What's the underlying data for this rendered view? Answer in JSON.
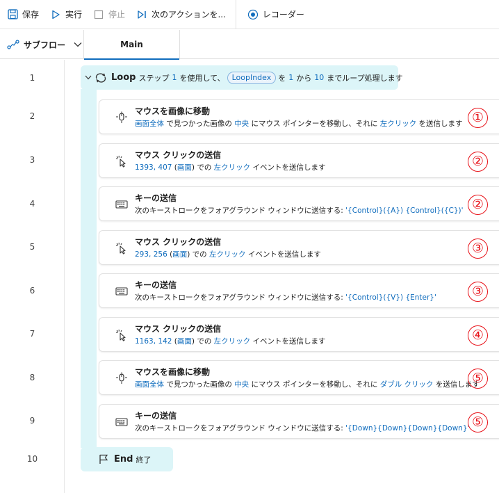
{
  "toolbar": {
    "save": "保存",
    "run": "実行",
    "stop": "停止",
    "next_action": "次のアクションを...",
    "recorder": "レコーダー"
  },
  "tabs": {
    "subflow": "サブフロー",
    "main": "Main"
  },
  "line_numbers": [
    "1",
    "2",
    "3",
    "4",
    "5",
    "6",
    "7",
    "8",
    "9",
    "10"
  ],
  "loop": {
    "keyword": "Loop",
    "t1": "ステップ",
    "step": "1",
    "t2": "を使用して、",
    "var": "LoopIndex",
    "t3": "を",
    "from": "1",
    "t4": "から",
    "to": "10",
    "t5": "までループ処理します"
  },
  "end": {
    "keyword": "End",
    "label": "終了"
  },
  "actions": [
    {
      "title": "マウスを画像に移動",
      "icon": "mouse-image-icon",
      "badge": "①",
      "desc": [
        {
          "t": "画面全体",
          "v": true
        },
        {
          "t": " で見つかった画像の "
        },
        {
          "t": "中央",
          "v": true
        },
        {
          "t": " にマウス ポインターを移動し、それに "
        },
        {
          "t": "左クリック",
          "v": true
        },
        {
          "t": " を送信します"
        }
      ]
    },
    {
      "title": "マウス クリックの送信",
      "icon": "mouse-click-icon",
      "badge": "②",
      "desc": [
        {
          "t": "1393, 407",
          "v": true
        },
        {
          "t": " ("
        },
        {
          "t": "画面",
          "v": true
        },
        {
          "t": ") での "
        },
        {
          "t": "左クリック",
          "v": true
        },
        {
          "t": " イベントを送信します"
        }
      ]
    },
    {
      "title": "キーの送信",
      "icon": "keyboard-icon",
      "badge": "②",
      "desc": [
        {
          "t": "次のキーストロークをフォアグラウンド ウィンドウに送信する: "
        },
        {
          "t": "'{Control}({A}) {Control}({C})'",
          "v": true
        }
      ]
    },
    {
      "title": "マウス クリックの送信",
      "icon": "mouse-click-icon",
      "badge": "③",
      "desc": [
        {
          "t": "293, 256",
          "v": true
        },
        {
          "t": " ("
        },
        {
          "t": "画面",
          "v": true
        },
        {
          "t": ") での "
        },
        {
          "t": "左クリック",
          "v": true
        },
        {
          "t": " イベントを送信します"
        }
      ]
    },
    {
      "title": "キーの送信",
      "icon": "keyboard-icon",
      "badge": "③",
      "desc": [
        {
          "t": "次のキーストロークをフォアグラウンド ウィンドウに送信する: "
        },
        {
          "t": "'{Control}({V}) {Enter}'",
          "v": true
        }
      ]
    },
    {
      "title": "マウス クリックの送信",
      "icon": "mouse-click-icon",
      "badge": "④",
      "desc": [
        {
          "t": "1163, 142",
          "v": true
        },
        {
          "t": " ("
        },
        {
          "t": "画面",
          "v": true
        },
        {
          "t": ") での "
        },
        {
          "t": "左クリック",
          "v": true
        },
        {
          "t": " イベントを送信します"
        }
      ]
    },
    {
      "title": "マウスを画像に移動",
      "icon": "mouse-image-icon",
      "badge": "⑤",
      "desc": [
        {
          "t": "画面全体",
          "v": true
        },
        {
          "t": " で見つかった画像の "
        },
        {
          "t": "中央",
          "v": true
        },
        {
          "t": " にマウス ポインターを移動し、それに "
        },
        {
          "t": "ダブル クリック",
          "v": true
        },
        {
          "t": " を送信します"
        }
      ]
    },
    {
      "title": "キーの送信",
      "icon": "keyboard-icon",
      "badge": "⑤",
      "desc": [
        {
          "t": "次のキーストロークをフォアグラウンド ウィンドウに送信する: "
        },
        {
          "t": "'{Down}{Down}{Down}{Down}'",
          "v": true
        }
      ]
    }
  ],
  "colors": {
    "accent": "#0f6cbd",
    "loop_bg": "#dcf5f8",
    "badge": "#e8141b"
  }
}
